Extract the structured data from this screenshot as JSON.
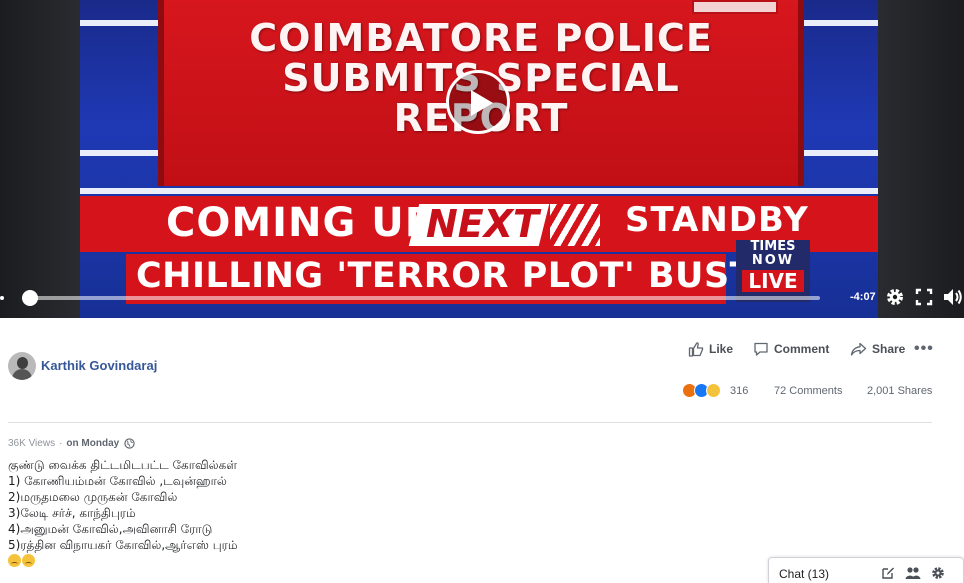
{
  "video": {
    "headline_line1": "COIMBATORE POLICE",
    "headline_line2": "SUBMITS SPECIAL",
    "headline_line3": "REPORT",
    "ticker_coming": "COMING UP",
    "ticker_next": "NEXT",
    "ticker_standby": "STANDBY",
    "ticker_story": "CHILLING 'TERROR PLOT' BUSTED",
    "channel_line1": "TIMES",
    "channel_line2": "NOW",
    "channel_line3": "LIVE",
    "time_remaining": "-4:07",
    "progress_fraction": 0.0,
    "icons": [
      "play-icon",
      "settings-icon",
      "fullscreen-icon",
      "volume-icon"
    ]
  },
  "post": {
    "author": "Karthik Govindaraj",
    "actions": {
      "like": "Like",
      "comment": "Comment",
      "share": "Share"
    },
    "reaction_count": "316",
    "comments_count": "72 Comments",
    "shares_count": "2,001 Shares",
    "views": "36K Views",
    "separator": "·",
    "posted": "on Monday",
    "body_lines": [
      "குண்டு வைக்க திட்டமிடபட்ட கோவில்கள்",
      "1) கோணியம்மன் கோவில் ,டவுன்ஹால்",
      "2)மருதமலை முருகன் கோவில்",
      "3)லேடி சர்ச், காந்திபுரம்",
      "4)அனுமன் கோவில்,அவினாசி ரோடு",
      "5)ரத்தின விநாயகர் கோவில்,ஆர்எஸ் புரம்"
    ],
    "reaction_icons": [
      "angry-reaction-icon",
      "like-reaction-icon",
      "sad-reaction-icon"
    ],
    "colors": {
      "link": "#365899",
      "like_reaction": "#1877f2",
      "angry_reaction": "#e9710f",
      "sad_reaction": "#f5c33b"
    }
  },
  "chat": {
    "label": "Chat (13)"
  }
}
